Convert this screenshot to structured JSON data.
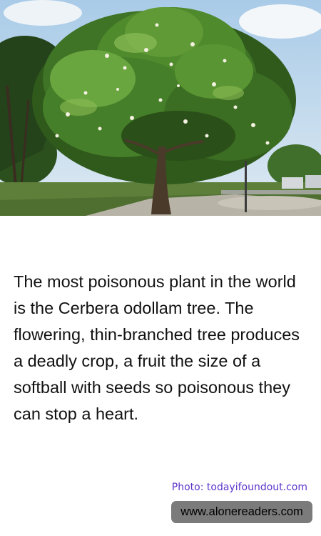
{
  "photo": {
    "subject": "Cerbera odollam tree",
    "colors": {
      "sky": "#b9d6ee",
      "foliage_dark": "#2f5a1c",
      "foliage_mid": "#4f8a2c",
      "foliage_light": "#8cbc55",
      "blossom": "#f2f0df",
      "trunk": "#4a3a2a",
      "path": "#b7b3a6"
    }
  },
  "fact_text": "The most poisonous plant in the world is the Cerbera odollam tree. The flowering, thin-branched tree produces a deadly crop, a fruit the size of a softball with seeds so poisonous they can stop a heart.",
  "photo_credit": "Photo: todayifoundout.com",
  "site_badge": "www.alonereaders.com"
}
